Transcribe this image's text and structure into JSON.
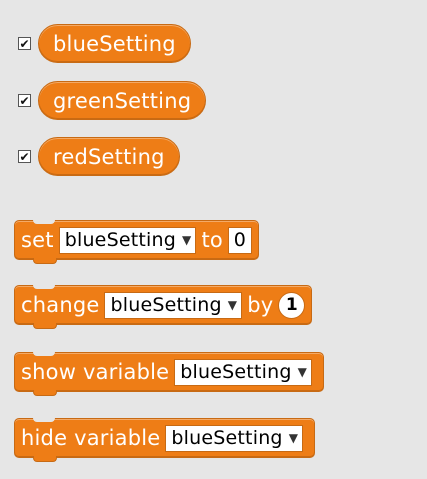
{
  "reporters": [
    {
      "checked": true,
      "label": "blueSetting"
    },
    {
      "checked": true,
      "label": "greenSetting"
    },
    {
      "checked": true,
      "label": "redSetting"
    }
  ],
  "checkbox_mark": "✔",
  "blocks": {
    "set": {
      "label": "set",
      "variable": "blueSetting",
      "word": "to",
      "value": "0"
    },
    "change": {
      "label": "change",
      "variable": "blueSetting",
      "word": "by",
      "value": "1"
    },
    "show": {
      "label": "show variable",
      "variable": "blueSetting"
    },
    "hide": {
      "label": "hide variable",
      "variable": "blueSetting"
    }
  },
  "dropdown_arrow": "▼",
  "colors": {
    "block": "#ee7d16",
    "background": "#e6e6e6"
  }
}
